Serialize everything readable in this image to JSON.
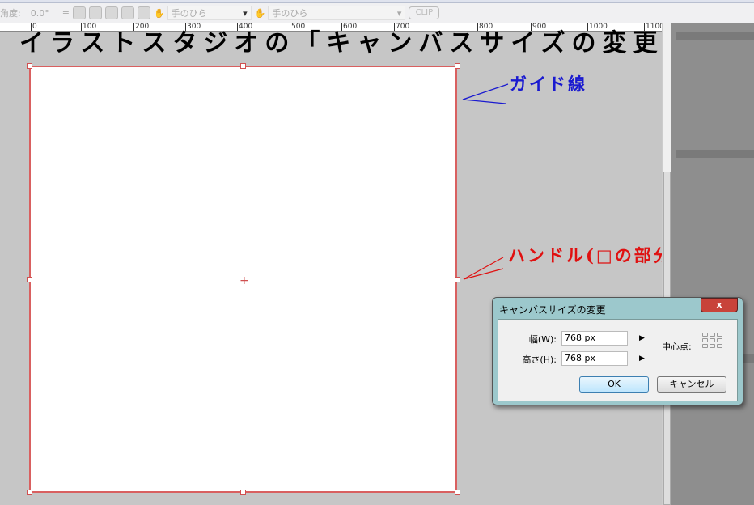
{
  "toolbar": {
    "angle_label": "角度:",
    "angle_value": "0.0°",
    "tool1": "手のひら",
    "tool2": "手のひら",
    "clip_label": "CLIP"
  },
  "ruler": [
    "0",
    "100",
    "200",
    "300",
    "400",
    "500",
    "600",
    "700",
    "800",
    "900",
    "1000",
    "1100"
  ],
  "title": "イラストスタジオの「キャンバスサイズの変更」",
  "annotations": {
    "guide": "ガイド線",
    "handle": "ハンドル(□の部分)"
  },
  "colors": {
    "guide": "#1a1ad0",
    "handle": "#e01010",
    "canvas_border": "#d96060"
  },
  "dialog": {
    "title": "キャンバスサイズの変更",
    "close": "x",
    "width_label": "幅(W):",
    "width_value": "768 px",
    "height_label": "高さ(H):",
    "height_value": "768 px",
    "center_label": "中心点:",
    "ok": "OK",
    "cancel": "キャンセル"
  }
}
